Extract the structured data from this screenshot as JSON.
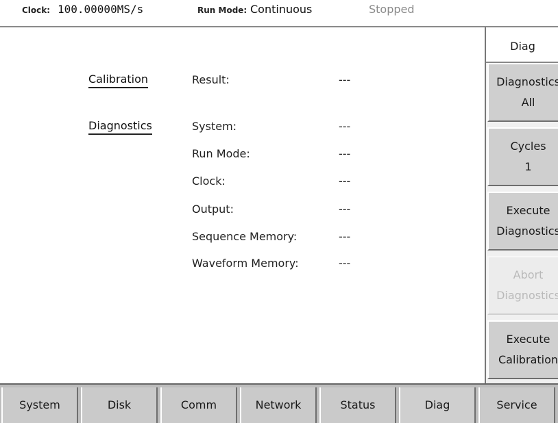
{
  "topbar": {
    "clock_label": "Clock:",
    "clock_value": "100.00000MS/s",
    "runmode_label": "Run Mode:",
    "runmode_value": "Continuous",
    "status": "Stopped"
  },
  "main": {
    "calibration_heading": "Calibration",
    "diagnostics_heading": "Diagnostics",
    "rows": [
      {
        "label": "Result:",
        "value": "---"
      },
      {
        "label": "System:",
        "value": "---"
      },
      {
        "label": "Run Mode:",
        "value": "---"
      },
      {
        "label": "Clock:",
        "value": "---"
      },
      {
        "label": "Output:",
        "value": "---"
      },
      {
        "label": "Sequence Memory:",
        "value": "---"
      },
      {
        "label": "Waveform Memory:",
        "value": "---"
      }
    ]
  },
  "sidebar": {
    "title": "Diag",
    "buttons": [
      {
        "line1": "Diagnostics",
        "line2": "All",
        "enabled": true
      },
      {
        "line1": "Cycles",
        "line2": "1",
        "enabled": true
      },
      {
        "line1": "Execute",
        "line2": "Diagnostics",
        "enabled": true
      },
      {
        "line1": "Abort",
        "line2": "Diagnostics",
        "enabled": false
      },
      {
        "line1": "Execute",
        "line2": "Calibration",
        "enabled": true
      }
    ]
  },
  "bottom_tabs": [
    {
      "label": "System"
    },
    {
      "label": "Disk"
    },
    {
      "label": "Comm"
    },
    {
      "label": "Network"
    },
    {
      "label": "Status"
    },
    {
      "label": "Diag",
      "active": true
    },
    {
      "label": "Service"
    }
  ]
}
